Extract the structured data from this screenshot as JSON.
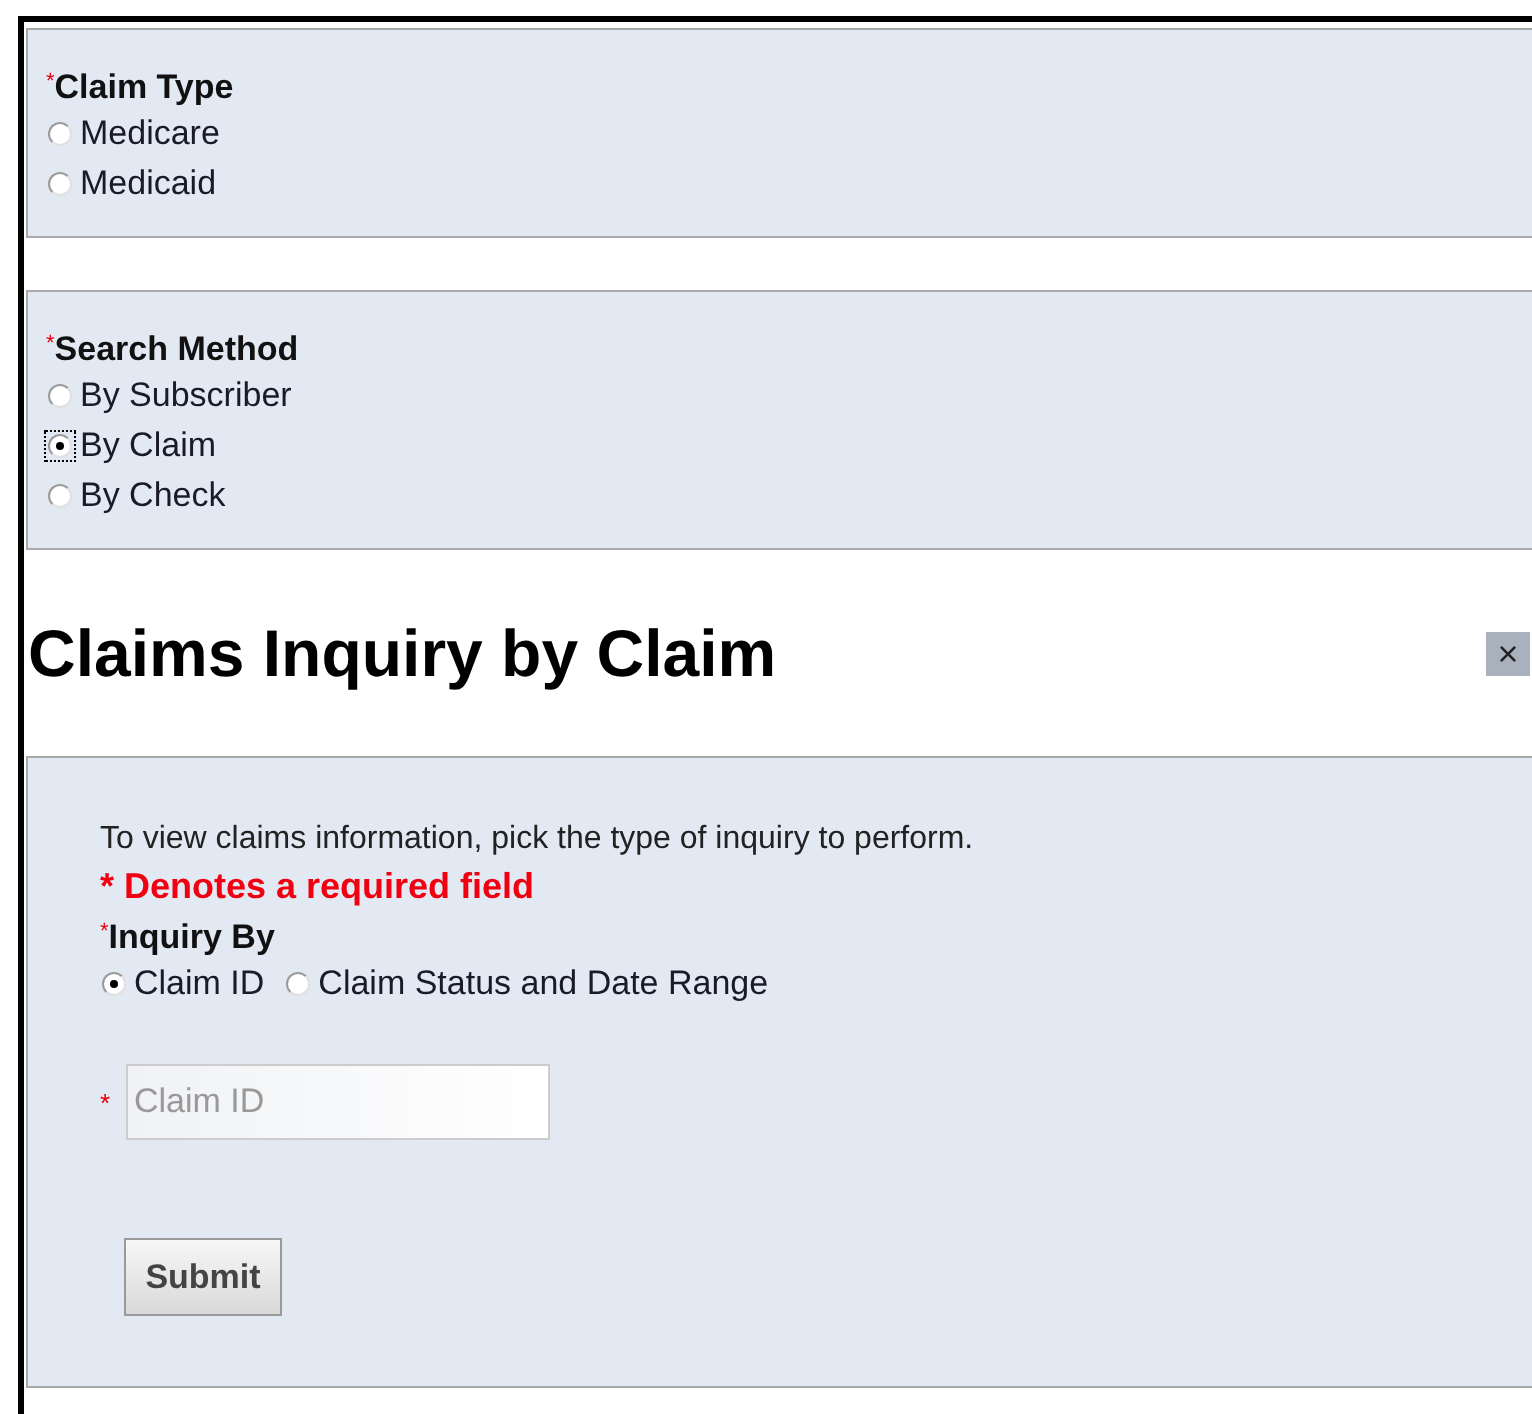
{
  "claim_type": {
    "required_mark": "*",
    "label": "Claim Type",
    "options": [
      {
        "label": "Medicare",
        "selected": false
      },
      {
        "label": "Medicaid",
        "selected": false
      }
    ]
  },
  "search_method": {
    "required_mark": "*",
    "label": "Search Method",
    "options": [
      {
        "label": "By Subscriber",
        "selected": false,
        "focused": false
      },
      {
        "label": "By Claim",
        "selected": true,
        "focused": true
      },
      {
        "label": "By Check",
        "selected": false,
        "focused": false
      }
    ]
  },
  "dialog": {
    "title": "Claims Inquiry by Claim",
    "close": "×",
    "intro": "To view claims information, pick the type of inquiry to perform.",
    "required_note": "* Denotes a required field",
    "inquiry_by": {
      "required_mark": "*",
      "label": "Inquiry By",
      "options": [
        {
          "label": "Claim ID",
          "selected": true
        },
        {
          "label": "Claim Status and Date Range",
          "selected": false
        }
      ]
    },
    "claim_id_field": {
      "required_mark": "*",
      "placeholder": "Claim ID"
    },
    "submit": "Submit"
  }
}
